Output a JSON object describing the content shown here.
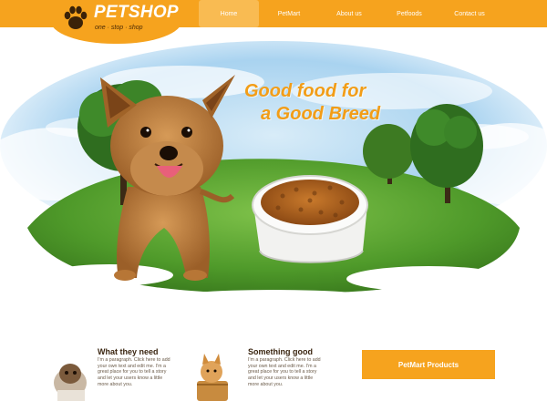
{
  "brand": {
    "name": "PETSHOP",
    "tagline": "one · stop · shop"
  },
  "nav": {
    "items": [
      {
        "label": "Home"
      },
      {
        "label": "PetMart"
      },
      {
        "label": "About us"
      },
      {
        "label": "Petfoods"
      },
      {
        "label": "Contact us"
      }
    ]
  },
  "hero": {
    "headline_line1": "Good food for",
    "headline_line2": "a Good Breed"
  },
  "columns": [
    {
      "heading": "What they need",
      "text": "I'm a paragraph. Click here to add your own text and edit me. I'm a great place for you to tell a story and let your users know a little more about you."
    },
    {
      "heading": "Something good",
      "text": "I'm a paragraph. Click here to add your own text and edit me. I'm a great place for you to tell a story and let your users know a little more about you."
    }
  ],
  "sidebar": {
    "products_label": "PetMart Products"
  },
  "colors": {
    "accent": "#f6a31e",
    "headline": "#f29d17",
    "grass": "#5aa332"
  },
  "icons": [
    "paw-icon"
  ]
}
